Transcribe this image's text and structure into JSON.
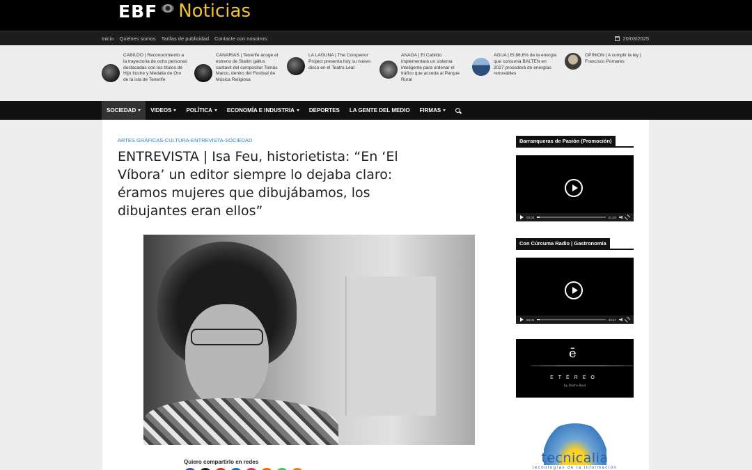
{
  "header": {
    "logo_brand": "EBF",
    "logo_word": "Noticias"
  },
  "topbar": {
    "links": [
      "Inicio",
      "Quiénes somos",
      "Tarifas de publicidad",
      "Contacte con nosotros:"
    ],
    "date": "20/03/2025"
  },
  "ticker": [
    "CABILDO | Reconocimiento a la trayectoria de ocho personas destacadas con los títulos de Hijo Ilustre y Medalla de Oro de la isla de Tenerife",
    "CANARIAS | Tenerife acoge el estreno de Statim gallus cantavit del compositor Tomás Marco, dentro del Festival de Música Religiosa",
    "LA LAGUNA | The Conqueror Project presenta hoy su nuevo disco en el Teatro Leal",
    "ANAGA | El Cabildo implementará un sistema inteligente para ordenar el tráfico que acceda al Parque Rural",
    "AGUA | El 86,6% de la energía que consuma BALTEN en 2027 procederá de energías renovables",
    "OPINIÓN | A cumplir la ley | Francisco Pomares"
  ],
  "mainnav": [
    "SOCIEDAD",
    "VIDEOS",
    "POLÍTICA",
    "ECONOMÍA E INDUSTRIA",
    "DEPORTES",
    "LA GENTE DEL MEDIO",
    "FIRMAS"
  ],
  "article": {
    "category": "ARTES GRÁFICAS-CULTURA-ENTREVISTA-SOCIEDAD",
    "title": "ENTREVISTA | Isa Feu, historietista: “En ‘El Víbora’ un editor siempre lo dejaba claro: éramos mujeres que dibujábamos, los dibujantes eran ellos”",
    "share_label": "Quiero compartirlo en redes",
    "share_colors": [
      "#3b5998",
      "#222222",
      "#c0392b",
      "#0077b5",
      "#e1306c",
      "#ff6600",
      "#25d366",
      "#e67e22"
    ]
  },
  "sidebar": {
    "widget1_title": "Barranqueras de Pasión (Promoción)",
    "video1": {
      "current": "00:00",
      "duration": "01:20"
    },
    "widget2_title": "Con Cúrcuma Radio | Gastronomía",
    "video2": {
      "current": "00:00",
      "duration": "00:57"
    },
    "etereo": {
      "mark": "ē",
      "name": "ETÉREO",
      "signature": "by Pedro Real"
    },
    "tecnicalia": {
      "name": "tecnicalia",
      "tagline": "tecnologías de la información"
    }
  }
}
